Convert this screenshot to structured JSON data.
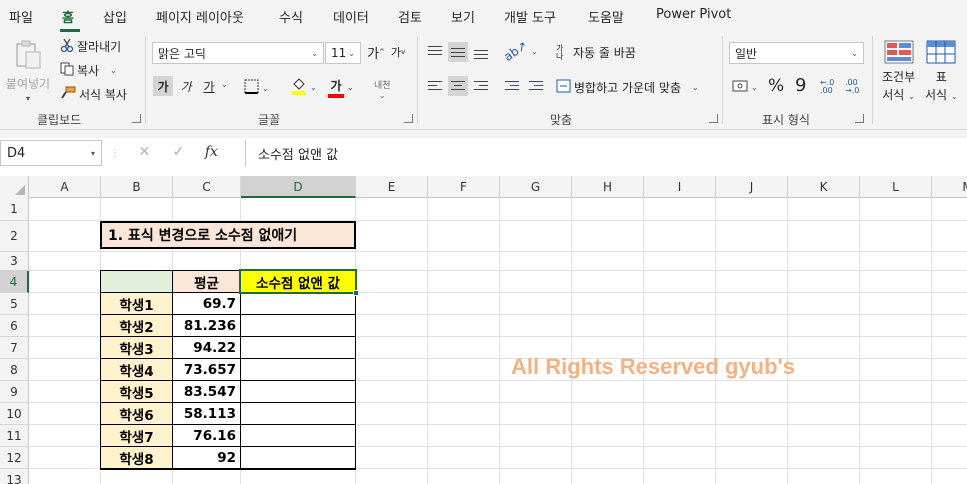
{
  "menu": {
    "tabs": [
      {
        "label": "파일"
      },
      {
        "label": "홈",
        "active": true
      },
      {
        "label": "삽입"
      },
      {
        "label": "페이지 레이아웃"
      },
      {
        "label": "수식"
      },
      {
        "label": "데이터"
      },
      {
        "label": "검토"
      },
      {
        "label": "보기"
      },
      {
        "label": "개발 도구"
      },
      {
        "label": "도움말"
      },
      {
        "label": "Power Pivot"
      }
    ]
  },
  "ribbon": {
    "clipboard": {
      "paste": "붙여넣기",
      "cut": "잘라내기",
      "copy": "복사",
      "format_painter": "서식 복사",
      "group_label": "클립보드"
    },
    "font": {
      "font_name": "맑은 고딕",
      "font_size": "11",
      "grow": "가",
      "shrink": "가",
      "bold": "가",
      "italic": "가",
      "underline": "가",
      "font_color_glyph": "가",
      "phonetic": "내천",
      "group_label": "글꼴",
      "highlight_color": "#ffff00",
      "font_color": "#ff0000"
    },
    "alignment": {
      "wrap_text": "자동 줄 바꿈",
      "merge_center": "병합하고 가운데 맞춤",
      "orientation_glyph": "가나",
      "group_label": "맞춤"
    },
    "number": {
      "format": "일반",
      "percent": "%",
      "comma": "9",
      "group_label": "표시 형식"
    },
    "styles": {
      "conditional": "조건부",
      "conditional_sub": "서식",
      "table": "표",
      "table_sub": "서식"
    }
  },
  "formula_bar": {
    "name_box": "D4",
    "fx": "fx",
    "content": "소수점 없앤 값"
  },
  "sheet": {
    "columns": [
      "A",
      "B",
      "C",
      "D",
      "E",
      "F",
      "G",
      "H",
      "I",
      "J",
      "K",
      "L",
      "M"
    ],
    "selected_column": "D",
    "rows": [
      "1",
      "2",
      "3",
      "4",
      "5",
      "6",
      "7",
      "8",
      "9",
      "10",
      "11",
      "12",
      "13"
    ],
    "selected_row": "4",
    "title": "1. 표식 변경으로 소수점 없애기",
    "table_header": {
      "b": "",
      "c": "평균",
      "d": "소수점 없앤 값"
    },
    "table_rows": [
      {
        "name": "학생1",
        "avg": "69.7",
        "d": ""
      },
      {
        "name": "학생2",
        "avg": "81.236",
        "d": ""
      },
      {
        "name": "학생3",
        "avg": "94.22",
        "d": ""
      },
      {
        "name": "학생4",
        "avg": "73.657",
        "d": ""
      },
      {
        "name": "학생5",
        "avg": "83.547",
        "d": ""
      },
      {
        "name": "학생6",
        "avg": "58.113",
        "d": ""
      },
      {
        "name": "학생7",
        "avg": "76.16",
        "d": ""
      },
      {
        "name": "학생8",
        "avg": "92",
        "d": ""
      }
    ],
    "watermark": "All Rights Reserved gyub's"
  },
  "colors": {
    "accent": "#1e6b3e",
    "title_fill": "#fbe5d6",
    "header_blank_fill": "#e2efda",
    "header_d_fill": "#ffff00",
    "name_fill": "#fff2cc",
    "watermark": "#f4b183"
  }
}
